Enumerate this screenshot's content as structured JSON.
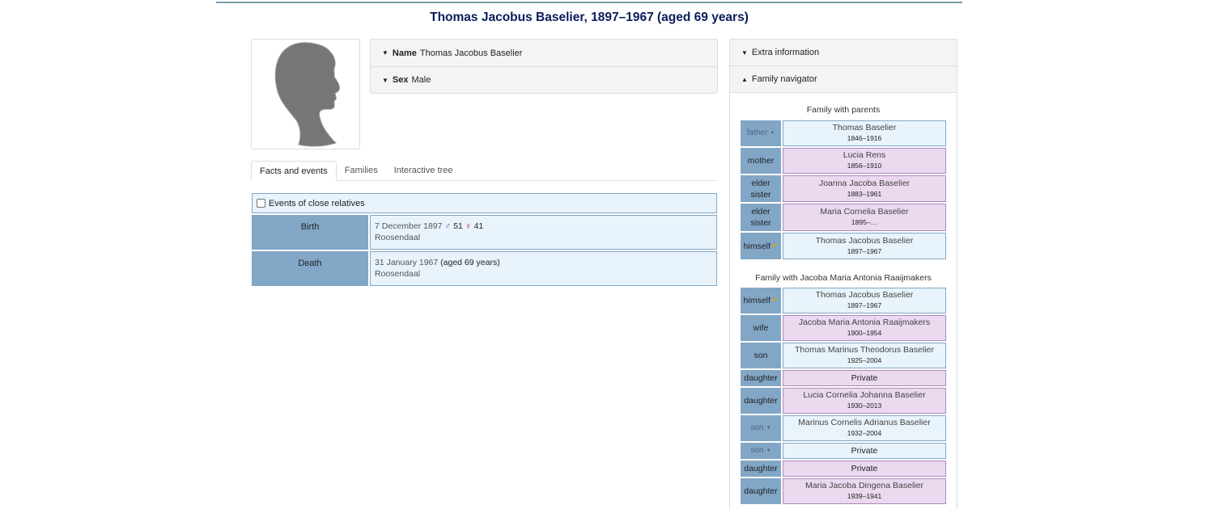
{
  "page_title": "Thomas Jacobus Baselier, 1897–1967 (aged 69 years)",
  "summary": [
    {
      "key": "Name",
      "value": "Thomas Jacobus Baselier"
    },
    {
      "key": "Sex",
      "value": "Male"
    }
  ],
  "tabs": [
    "Facts and events",
    "Families",
    "Interactive tree"
  ],
  "events_checkbox_label": "Events of close relatives",
  "events": {
    "birth": {
      "label": "Birth",
      "date": "7 December 1897",
      "father_age_sym": "♂",
      "father_age": "51",
      "mother_age_sym": "♀",
      "mother_age": "41",
      "place": "Roosendaal"
    },
    "death": {
      "label": "Death",
      "date": "31 January 1967",
      "age": "(aged 69 years)",
      "place": "Roosendaal"
    }
  },
  "sidebar": {
    "extra_info": "Extra information",
    "family_navigator": "Family navigator"
  },
  "families": {
    "parents": {
      "title": "Family with parents",
      "members": [
        {
          "role": "father",
          "name": "Thomas Baselier",
          "years": "1846–1916"
        },
        {
          "role": "mother",
          "name": "Lucia Rens",
          "years": "1856–1910"
        },
        {
          "role": "elder sister",
          "name": "Joanna Jacoba Baselier",
          "years": "1883–1961"
        },
        {
          "role": "elder sister",
          "name": "Maria Cornelia Baselier",
          "years": "1895–…"
        },
        {
          "role": "himself",
          "name": "Thomas Jacobus Baselier",
          "years": "1897–1967"
        }
      ]
    },
    "spouse": {
      "title": "Family with Jacoba Maria Antonia Raaijmakers",
      "members": [
        {
          "role": "himself",
          "name": "Thomas Jacobus Baselier",
          "years": "1897–1967"
        },
        {
          "role": "wife",
          "name": "Jacoba Maria Antonia Raaijmakers",
          "years": "1900–1954"
        },
        {
          "role": "son",
          "name": "Thomas Marinus Theodorus Baselier",
          "years": "1925–2004"
        },
        {
          "role": "daughter",
          "name": "Private",
          "years": ""
        },
        {
          "role": "daughter",
          "name": "Lucia Cornelia Johanna Baselier",
          "years": "1930–2013"
        },
        {
          "role": "son",
          "name": "Marinus Cornelis Adrianus Baselier",
          "years": "1932–2004"
        },
        {
          "role": "son",
          "name": "Private",
          "years": ""
        },
        {
          "role": "daughter",
          "name": "Private",
          "years": ""
        },
        {
          "role": "daughter",
          "name": "Maria Jacoba Dingena Baselier",
          "years": "1939–1941"
        }
      ]
    }
  }
}
